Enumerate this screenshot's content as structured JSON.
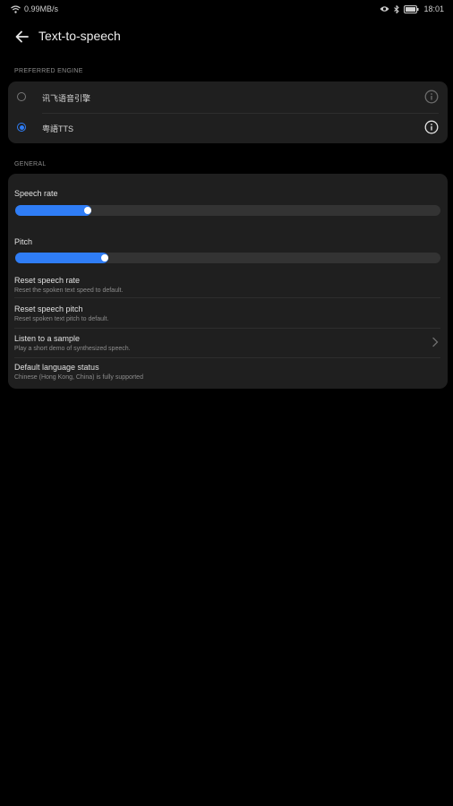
{
  "status_bar": {
    "net_speed": "0.99MB/s",
    "time": "18:01"
  },
  "header": {
    "title": "Text-to-speech"
  },
  "preferred_engine": {
    "label": "PREFERRED ENGINE",
    "engines": [
      {
        "name": "讯飞语音引擎",
        "selected": false
      },
      {
        "name": "粤語TTS",
        "selected": true
      }
    ]
  },
  "general": {
    "label": "GENERAL",
    "speech_rate": {
      "label": "Speech rate",
      "value": 0.17
    },
    "pitch": {
      "label": "Pitch",
      "value": 0.21
    },
    "items": [
      {
        "title": "Reset speech rate",
        "subtitle": "Reset the spoken text speed to default."
      },
      {
        "title": "Reset speech pitch",
        "subtitle": "Reset spoken text pitch to default."
      },
      {
        "title": "Listen to a sample",
        "subtitle": "Play a short demo of synthesized speech."
      },
      {
        "title": "Default language status",
        "subtitle": "Chinese (Hong Kong, China) is fully supported"
      }
    ]
  },
  "colors": {
    "accent": "#2f7df6",
    "card": "#1f1f1f",
    "background": "#000000"
  }
}
